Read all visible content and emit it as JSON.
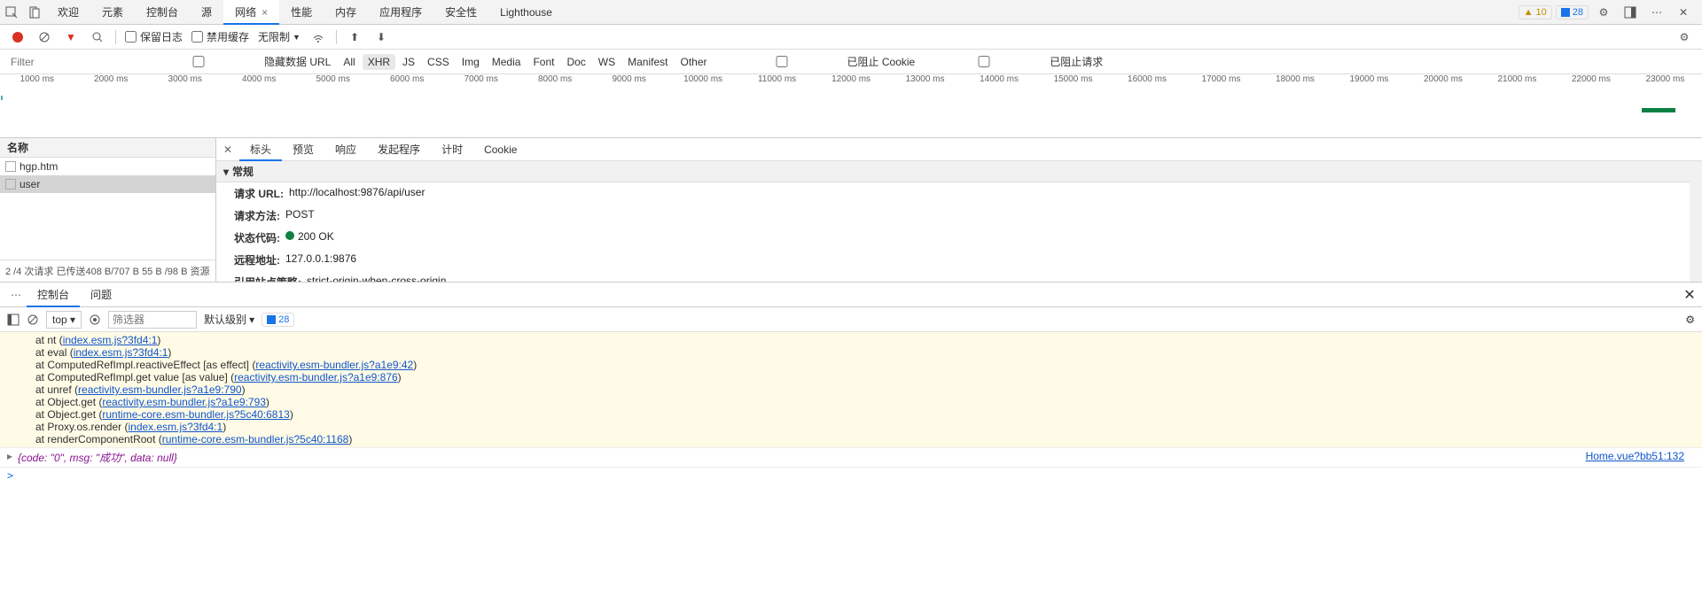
{
  "tabs": [
    "欢迎",
    "元素",
    "控制台",
    "源",
    "网络",
    "性能",
    "内存",
    "应用程序",
    "安全性",
    "Lighthouse"
  ],
  "active_tab": 4,
  "warn_count": "10",
  "info_count": "28",
  "net_toolbar": {
    "preserve_log": "保留日志",
    "disable_cache": "禁用缓存",
    "throttling": "无限制"
  },
  "filter": {
    "placeholder": "Filter",
    "hide_data_urls": "隐藏数据 URL",
    "types": [
      "All",
      "XHR",
      "JS",
      "CSS",
      "Img",
      "Media",
      "Font",
      "Doc",
      "WS",
      "Manifest",
      "Other"
    ],
    "active_type": 1,
    "blocked_cookies": "已阻止 Cookie",
    "blocked_requests": "已阻止请求"
  },
  "timeline_ticks": [
    "1000 ms",
    "2000 ms",
    "3000 ms",
    "4000 ms",
    "5000 ms",
    "6000 ms",
    "7000 ms",
    "8000 ms",
    "9000 ms",
    "10000 ms",
    "11000 ms",
    "12000 ms",
    "13000 ms",
    "14000 ms",
    "15000 ms",
    "16000 ms",
    "17000 ms",
    "18000 ms",
    "19000 ms",
    "20000 ms",
    "21000 ms",
    "22000 ms",
    "23000 ms"
  ],
  "requests": {
    "header": "名称",
    "items": [
      {
        "name": "hgp.htm",
        "selected": false
      },
      {
        "name": "user",
        "selected": true
      }
    ],
    "status": "2 /4 次请求   已传送408 B/707 B   55 B /98 B  资源"
  },
  "detail_tabs": [
    "标头",
    "预览",
    "响应",
    "发起程序",
    "计时",
    "Cookie"
  ],
  "active_detail_tab": 0,
  "general": {
    "header": "常规",
    "rows": [
      {
        "k": "请求 URL:",
        "v": "http://localhost:9876/api/user"
      },
      {
        "k": "请求方法:",
        "v": "POST"
      },
      {
        "k": "状态代码:",
        "v": "200 OK",
        "status": true
      },
      {
        "k": "远程地址:",
        "v": "127.0.0.1:9876"
      },
      {
        "k": "引用站点策略:",
        "v": "strict-origin-when-cross-origin"
      }
    ]
  },
  "drawer": {
    "tabs": [
      "控制台",
      "问题"
    ],
    "active": 0,
    "context": "top",
    "filter_placeholder": "筛选器",
    "level": "默认级别",
    "badge": "28"
  },
  "stack": [
    {
      "pre": "at nt (",
      "link": "index.esm.js?3fd4:1",
      "post": ")"
    },
    {
      "pre": "at eval (",
      "link": "index.esm.js?3fd4:1",
      "post": ")"
    },
    {
      "pre": "at ComputedRefImpl.reactiveEffect [as effect] (",
      "link": "reactivity.esm-bundler.js?a1e9:42",
      "post": ")"
    },
    {
      "pre": "at ComputedRefImpl.get value [as value] (",
      "link": "reactivity.esm-bundler.js?a1e9:876",
      "post": ")"
    },
    {
      "pre": "at unref (",
      "link": "reactivity.esm-bundler.js?a1e9:790",
      "post": ")"
    },
    {
      "pre": "at Object.get (",
      "link": "reactivity.esm-bundler.js?a1e9:793",
      "post": ")"
    },
    {
      "pre": "at Object.get (",
      "link": "runtime-core.esm-bundler.js?5c40:6813",
      "post": ")"
    },
    {
      "pre": "at Proxy.os.render (",
      "link": "index.esm.js?3fd4:1",
      "post": ")"
    },
    {
      "pre": "at renderComponentRoot (",
      "link": "runtime-core.esm-bundler.js?5c40:1168",
      "post": ")"
    }
  ],
  "obj_line": {
    "text": "{code: \"0\", msg: \"成功\", data: null}",
    "src": "Home.vue?bb51:132"
  },
  "prompt": ">"
}
